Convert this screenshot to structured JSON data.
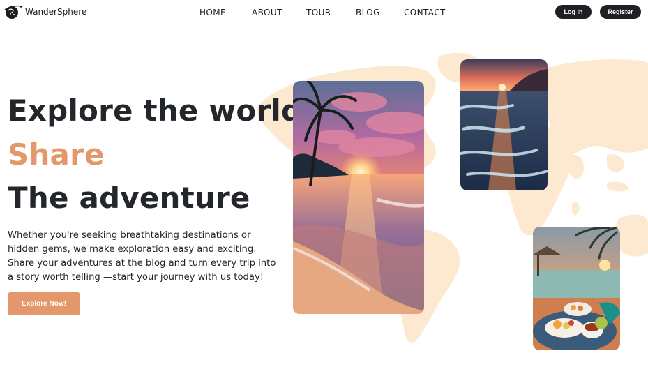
{
  "brand": {
    "name": "WanderSphere",
    "logo_icon": "globe-airplane-icon"
  },
  "nav": {
    "links": [
      "HOME",
      "ABOUT",
      "TOUR",
      "BLOG",
      "CONTACT"
    ]
  },
  "auth": {
    "login_label": "Log in",
    "register_label": "Register"
  },
  "hero": {
    "title_line1": "Explore the world,",
    "title_line2": "Share",
    "title_line3": "The adventure",
    "description_lines": [
      "Whether you're seeking breathtaking destinations or",
      "hidden gems, we make exploration easy and exciting.",
      "Share your adventures at the blog and turn every trip into",
      "a story worth telling —start your journey with us today!"
    ],
    "cta_label": "Explore Now!"
  },
  "colors": {
    "accent": "#e3976a",
    "dark": "#1f2024",
    "map": "#fde9cf",
    "text": "#23272b"
  }
}
